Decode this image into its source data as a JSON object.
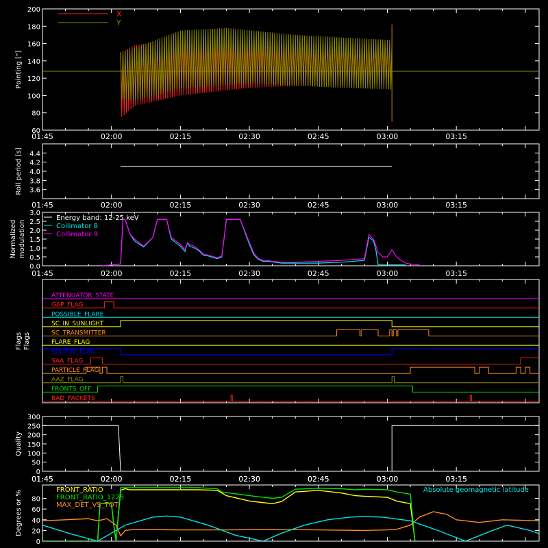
{
  "time_ticks": [
    "01:45",
    "02:00",
    "02:15",
    "02:30",
    "02:45",
    "03:00",
    "03:15"
  ],
  "colors": {
    "background": "#000000",
    "axes": "#ffffff",
    "red": "#ff2020",
    "olive": "#8c8c00",
    "white": "#ffffff",
    "cyan": "#00e6e6",
    "magenta": "#ff00ff",
    "green": "#00e600",
    "yellow": "#ffff00",
    "orange": "#ff8c1a",
    "blue": "#0000ff",
    "dark_olive": "#8c8c00"
  },
  "chart_data": [
    {
      "id": "pointing",
      "type": "line",
      "ylabel": "Pointing [\"]",
      "ylim": [
        60,
        200
      ],
      "yticks": [
        60,
        80,
        100,
        120,
        140,
        160,
        180,
        200
      ],
      "xlim_minutes": [
        0,
        108
      ],
      "legend": [
        "X",
        "Y"
      ],
      "series": [
        {
          "name": "X",
          "color": "red",
          "active": [
            17,
            76
          ],
          "upper": [
            [
              17,
              150
            ],
            [
              20,
              158
            ],
            [
              30,
              165
            ],
            [
              45,
              164
            ],
            [
              60,
              161
            ],
            [
              76,
              159
            ]
          ],
          "lower": [
            [
              17,
              74
            ],
            [
              20,
              88
            ],
            [
              30,
              100
            ],
            [
              45,
              109
            ],
            [
              60,
              112
            ],
            [
              76,
              113
            ]
          ]
        },
        {
          "name": "Y",
          "color": "olive",
          "active": [
            17,
            76
          ],
          "upper": [
            [
              17,
              150
            ],
            [
              20,
              155
            ],
            [
              30,
              175
            ],
            [
              40,
              178
            ],
            [
              55,
              170
            ],
            [
              76,
              164
            ]
          ],
          "lower": [
            [
              17,
              96
            ],
            [
              20,
              94
            ],
            [
              30,
              108
            ],
            [
              45,
              114
            ],
            [
              60,
              110
            ],
            [
              76,
              107
            ]
          ],
          "baseline": 128
        }
      ]
    },
    {
      "id": "roll-period",
      "type": "line",
      "ylabel": "Roll period [s]",
      "ylim": [
        3.4,
        4.6
      ],
      "yticks": [
        3.6,
        3.8,
        4.0,
        4.2,
        4.4
      ],
      "series": [
        {
          "name": "",
          "color": "white",
          "x": [
            17,
            76
          ],
          "y": [
            4.1,
            4.1
          ]
        }
      ]
    },
    {
      "id": "modulation",
      "type": "line",
      "ylabel": "Normalized modulation",
      "ylim": [
        0,
        3.0
      ],
      "yticks": [
        0.0,
        0.5,
        1.0,
        1.5,
        2.0,
        2.5,
        3.0
      ],
      "legend_title": "Energy band: 12-25 keV",
      "series": [
        {
          "name": "Collimator 8",
          "color": "cyan",
          "x": [
            13,
            17,
            17.5,
            18,
            19,
            20,
            22,
            24,
            25,
            26,
            27,
            28,
            30,
            31,
            31.5,
            32,
            33,
            34,
            35,
            36,
            38,
            39,
            40,
            41,
            42,
            43,
            45,
            46,
            47,
            48,
            49,
            50,
            52,
            55,
            60,
            65,
            70,
            71,
            72,
            72.5,
            73,
            74,
            78,
            79
          ],
          "y": [
            0,
            0.1,
            2.6,
            2.6,
            1.8,
            1.4,
            1.05,
            1.6,
            2.6,
            2.6,
            2.6,
            1.5,
            1.1,
            0.8,
            1.3,
            1.1,
            1.0,
            0.85,
            0.6,
            0.55,
            0.4,
            0.5,
            2.6,
            2.6,
            2.6,
            2.6,
            1.2,
            0.6,
            0.35,
            0.25,
            0.25,
            0.22,
            0.15,
            0.15,
            0.15,
            0.2,
            0.3,
            1.6,
            1.4,
            0.9,
            0.05,
            0.05,
            0.05,
            0.05
          ]
        },
        {
          "name": "Collimator 9",
          "color": "magenta",
          "x": [
            13,
            17,
            17.5,
            18,
            19,
            20,
            22,
            24,
            25,
            26,
            27,
            28,
            30,
            31,
            31.5,
            32,
            33,
            34,
            35,
            36,
            38,
            39,
            40,
            41,
            42,
            43,
            45,
            46,
            47,
            48,
            49,
            50,
            52,
            55,
            60,
            65,
            70,
            71,
            72,
            73,
            74,
            75,
            76,
            77,
            78,
            79,
            80,
            82
          ],
          "y": [
            0,
            0.1,
            2.6,
            2.6,
            1.8,
            1.5,
            1.1,
            1.6,
            2.6,
            2.6,
            2.6,
            1.6,
            1.2,
            0.9,
            1.3,
            1.2,
            1.1,
            0.9,
            0.65,
            0.6,
            0.45,
            0.55,
            2.6,
            2.6,
            2.6,
            2.6,
            1.3,
            0.7,
            0.4,
            0.3,
            0.3,
            0.25,
            0.2,
            0.2,
            0.25,
            0.3,
            0.4,
            1.75,
            1.5,
            0.75,
            0.5,
            0.5,
            0.9,
            0.5,
            0.3,
            0.15,
            0.1,
            0.05
          ]
        }
      ]
    },
    {
      "id": "flags",
      "type": "line",
      "ylabel": "Flags",
      "series": [
        {
          "name": "ATTENUATOR_STATE",
          "color": "magenta",
          "levels": [
            [
              0,
              0
            ]
          ]
        },
        {
          "name": "GAP_FLAG",
          "color": "red",
          "levels": [
            [
              0,
              0
            ],
            [
              13.5,
              1
            ],
            [
              15.5,
              0
            ]
          ]
        },
        {
          "name": "POSSIBLE_FLARE",
          "color": "cyan",
          "levels": [
            [
              0,
              0
            ]
          ]
        },
        {
          "name": "SC_IN_SUNLIGHT",
          "color": "yellow",
          "levels": [
            [
              0,
              0
            ],
            [
              17,
              1
            ],
            [
              76,
              0
            ]
          ]
        },
        {
          "name": "SC_TRANSMITTER",
          "color": "orange",
          "levels": [
            [
              0,
              0
            ],
            [
              64,
              1
            ],
            [
              69,
              0
            ],
            [
              69.3,
              1
            ],
            [
              73,
              0
            ],
            [
              75.5,
              1
            ],
            [
              76,
              0
            ],
            [
              76.3,
              1
            ],
            [
              77,
              0
            ],
            [
              77.3,
              1
            ],
            [
              84,
              0
            ]
          ]
        },
        {
          "name": "FLARE_FLAG",
          "color": "yellow",
          "levels": [
            [
              0,
              0
            ]
          ]
        },
        {
          "name": "ECLIPSE_FLAG",
          "color": "blue",
          "levels": [
            [
              0,
              1
            ],
            [
              17,
              0
            ],
            [
              76,
              1
            ]
          ]
        },
        {
          "name": "SAA_FLAG",
          "color": "red",
          "levels": [
            [
              0,
              0
            ],
            [
              10.5,
              1
            ],
            [
              13,
              0
            ],
            [
              104,
              1
            ]
          ]
        },
        {
          "name": "PARTICLE_FLAG",
          "color": "orange",
          "levels": [
            [
              0,
              0
            ],
            [
              9.5,
              1
            ],
            [
              12.5,
              0
            ],
            [
              13,
              1
            ],
            [
              14,
              0
            ],
            [
              80,
              1
            ],
            [
              94,
              0
            ],
            [
              95,
              1
            ],
            [
              97,
              0
            ],
            [
              103,
              1
            ],
            [
              104,
              0
            ],
            [
              105,
              1
            ],
            [
              106,
              0
            ]
          ]
        },
        {
          "name": "AAZ_FLAG",
          "color": "dark_olive",
          "levels": [
            [
              0,
              0
            ],
            [
              17,
              1
            ],
            [
              17.5,
              0
            ],
            [
              76,
              1
            ],
            [
              76.5,
              0
            ]
          ]
        },
        {
          "name": "FRONTS_OFF",
          "color": "green",
          "levels": [
            [
              0,
              0
            ],
            [
              12,
              1
            ],
            [
              80.5,
              0
            ]
          ]
        },
        {
          "name": "BAD_PACKETS",
          "color": "red",
          "levels": [
            [
              0,
              0
            ],
            [
              41,
              1
            ],
            [
              41.3,
              0
            ],
            [
              93,
              1
            ],
            [
              93.3,
              0
            ]
          ]
        }
      ]
    },
    {
      "id": "quality",
      "type": "line",
      "ylabel": "Quality",
      "ylim": [
        0,
        300
      ],
      "yticks": [
        0,
        50,
        100,
        150,
        200,
        250,
        300
      ],
      "series": [
        {
          "name": "",
          "color": "white",
          "x": [
            0,
            16.5,
            17,
            17.5,
            76,
            76,
            108
          ],
          "y": [
            250,
            250,
            0,
            0,
            0,
            250,
            250
          ]
        }
      ]
    },
    {
      "id": "front-ratio",
      "type": "line",
      "ylabel": "Degrees or %",
      "ylim": [
        0,
        105
      ],
      "yticks": [
        0,
        20,
        40,
        60,
        80
      ],
      "series": [
        {
          "name": "FRONT_RATIO",
          "color": "yellow",
          "x": [
            0,
            12,
            12.5,
            15,
            15.5,
            16,
            17,
            18,
            19,
            26,
            30,
            34,
            38,
            40,
            45,
            50,
            52,
            55,
            60,
            65,
            68,
            70,
            75,
            77,
            80,
            81
          ],
          "y": [
            0,
            0,
            70,
            70,
            30,
            0,
            95,
            98,
            96,
            96,
            96,
            96,
            95,
            85,
            75,
            70,
            74,
            92,
            95,
            90,
            85,
            84,
            82,
            75,
            70,
            0
          ]
        },
        {
          "name": "FRONT_RATIO_1225",
          "color": "green",
          "x": [
            0,
            12,
            12.5,
            15,
            15.5,
            16,
            17,
            18,
            19,
            26,
            30,
            34,
            38,
            39,
            45,
            50,
            52,
            55,
            60,
            65,
            68,
            70,
            75,
            77,
            80,
            81
          ],
          "y": [
            0,
            0,
            70,
            70,
            30,
            0,
            100,
            100,
            100,
            100,
            100,
            100,
            98,
            92,
            85,
            80,
            82,
            97,
            99,
            98,
            96,
            97,
            96,
            92,
            88,
            0
          ]
        },
        {
          "name": "MAX_DET_VS_TOT",
          "color": "orange",
          "x": [
            0,
            5,
            10,
            12,
            14,
            16,
            17,
            18,
            20,
            30,
            40,
            50,
            60,
            70,
            75,
            77,
            80,
            82,
            85,
            88,
            90,
            95,
            100,
            108
          ],
          "y": [
            38,
            40,
            42,
            38,
            42,
            30,
            10,
            20,
            22,
            21,
            21,
            22,
            21,
            20,
            21,
            22,
            30,
            45,
            55,
            50,
            40,
            35,
            40,
            38
          ]
        },
        {
          "name": "Absolute geomagnetic latitude",
          "color": "cyan",
          "x": [
            0,
            6,
            12,
            18,
            24,
            27,
            30,
            36,
            42,
            48,
            52,
            57,
            62,
            67,
            70,
            74,
            80,
            86,
            92,
            97,
            101,
            106,
            108
          ],
          "y": [
            30,
            14,
            0,
            30,
            45,
            47,
            45,
            30,
            11,
            0,
            15,
            30,
            40,
            45,
            46,
            45,
            38,
            20,
            0,
            17,
            30,
            20,
            14
          ]
        }
      ]
    }
  ]
}
